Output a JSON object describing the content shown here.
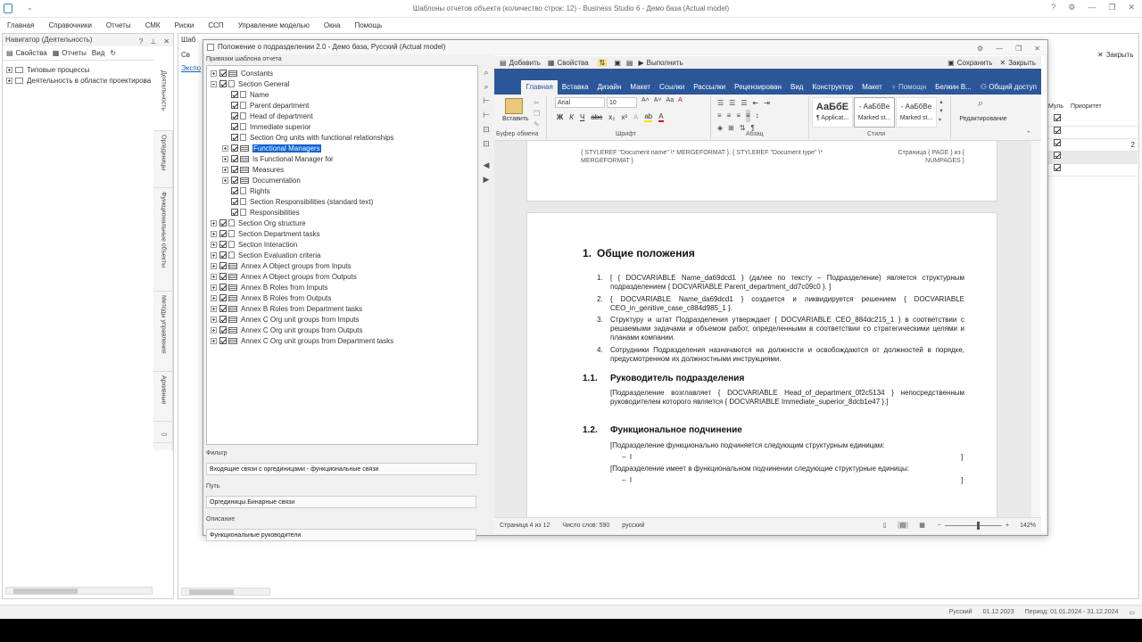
{
  "app": {
    "title": "Шаблоны отчетов объекта (количество строк: 12) - Business Studio 6 - Демо база (Actual model)"
  },
  "menu": [
    "Главная",
    "Справочники",
    "Отчеты",
    "СМК",
    "Риски",
    "ССП",
    "Управление моделью",
    "Окна",
    "Помощь"
  ],
  "navigator": {
    "title": "Навигатор (Деятельность)",
    "toolbar": {
      "properties": "Свойства",
      "reports": "Отчеты",
      "view": "Вид"
    },
    "items": [
      "Типовые процессы",
      "Деятельность в области проектирова"
    ],
    "side_tabs": [
      "Деятельность",
      "Оргединицы",
      "Функциональные объекты",
      "Методы управления",
      "Архивные"
    ]
  },
  "background_window": {
    "title_fragment": "Шаб",
    "tab_fragment": "Св",
    "export_fragment": "Экспо",
    "close_label": "Закрыть",
    "columns": {
      "mult": "Муль",
      "priority": "Приоритет"
    },
    "value": "2"
  },
  "dialog": {
    "title": "Положение о подразделении 2.0 - Демо база, Русский (Actual model)",
    "left_header": "Привязки шаблона отчета",
    "tree": [
      {
        "label": "Constants",
        "level": 0,
        "expand": "plus",
        "icon": "table"
      },
      {
        "label": "Section General",
        "level": 0,
        "expand": "minus",
        "icon": "bracket"
      },
      {
        "label": "Name",
        "level": 1,
        "expand": "none",
        "icon": "bracket"
      },
      {
        "label": "Parent department",
        "level": 1,
        "expand": "none",
        "icon": "bracket"
      },
      {
        "label": "Head of department",
        "level": 1,
        "expand": "none",
        "icon": "bracket"
      },
      {
        "label": "Immediate superior",
        "level": 1,
        "expand": "none",
        "icon": "bracket"
      },
      {
        "label": "Section Org units with functional relationships",
        "level": 1,
        "expand": "none",
        "icon": "bracket"
      },
      {
        "label": "Functional Managers",
        "level": 1,
        "expand": "plus",
        "icon": "table",
        "selected": true
      },
      {
        "label": "Is Functional Manager for",
        "level": 1,
        "expand": "plus",
        "icon": "table"
      },
      {
        "label": "Measures",
        "level": 1,
        "expand": "plus",
        "icon": "table"
      },
      {
        "label": "Documentation",
        "level": 1,
        "expand": "plus",
        "icon": "table"
      },
      {
        "label": "Rights",
        "level": 1,
        "expand": "none",
        "icon": "bracket"
      },
      {
        "label": "Section Responsibilities (standard text)",
        "level": 1,
        "expand": "none",
        "icon": "bracket"
      },
      {
        "label": "Responsibilities",
        "level": 1,
        "expand": "none",
        "icon": "bracket"
      },
      {
        "label": "Section Org structure",
        "level": 0,
        "expand": "plus",
        "icon": "bracket"
      },
      {
        "label": "Section Department tasks",
        "level": 0,
        "expand": "plus",
        "icon": "bracket"
      },
      {
        "label": "Section Interaction",
        "level": 0,
        "expand": "plus",
        "icon": "bracket"
      },
      {
        "label": "Section Evaluation criteria",
        "level": 0,
        "expand": "plus",
        "icon": "bracket"
      },
      {
        "label": "Annex A Object groups from Inputs",
        "level": 0,
        "expand": "plus",
        "icon": "table"
      },
      {
        "label": "Annex A Object groups from Outputs",
        "level": 0,
        "expand": "plus",
        "icon": "table"
      },
      {
        "label": "Annex B Roles from Imputs",
        "level": 0,
        "expand": "plus",
        "icon": "table"
      },
      {
        "label": "Annex B Roles from Outputs",
        "level": 0,
        "expand": "plus",
        "icon": "table"
      },
      {
        "label": "Annex B Roles from Department tasks",
        "level": 0,
        "expand": "plus",
        "icon": "table"
      },
      {
        "label": "Annex C Org unit groups from Imputs",
        "level": 0,
        "expand": "plus",
        "icon": "table"
      },
      {
        "label": "Annex C Org unit groups from Outputs",
        "level": 0,
        "expand": "plus",
        "icon": "table"
      },
      {
        "label": "Annex C Org unit groups from Department tasks",
        "level": 0,
        "expand": "plus",
        "icon": "table"
      }
    ],
    "filter_label": "Фильтр",
    "filter_value": "Входящие связи с оргединицами - функциональные связи",
    "path_label": "Путь",
    "path_value": "Оргединицы.Бинарные связи",
    "desc_label": "Описание",
    "desc_value": "Функциональные руководители"
  },
  "word": {
    "toolbar": {
      "add": "Добавить",
      "properties": "Свойства",
      "execute": "Выполнить",
      "save": "Сохранить",
      "close": "Закрыть"
    },
    "ribbon_tabs": [
      "Главная",
      "Вставка",
      "Дизайн",
      "Макет",
      "Ссылки",
      "Рассылки",
      "Рецензирован",
      "Вид",
      "Конструктор",
      "Макет",
      "Помощн",
      "Белкин В...",
      "Общий доступ"
    ],
    "ribbon": {
      "paste": "Вставить",
      "clipboard": "Буфер обмена",
      "font_name": "Arial",
      "font_size": "10",
      "font_group": "Шрифт",
      "paragraph_group": "Абзац",
      "styles_group": "Стили",
      "styles": [
        {
          "preview": "АаБбЕ",
          "name": "¶ Applicat..."
        },
        {
          "preview": "- АаБбВе",
          "name": "Marked st..."
        },
        {
          "preview": "- АаБбВе",
          "name": "Marked st..."
        }
      ],
      "editing": "Редактирование"
    },
    "header_left": "{ STYLEREF \"Document name\" \\* MERGEFORMAT }. { STYLEREF \"Document type\" \\* MERGEFORMAT }",
    "header_right": "Страница { PAGE } из { NUMPAGES }",
    "doc": {
      "h1_num": "1.",
      "h1": "Общие положения",
      "items": [
        {
          "num": "1.",
          "text": "[ { DOCVARIABLE Name_da69dcd1 } (далее по тексту – Подразделение) является структурным подразделением { DOCVARIABLE Parent_department_dd7c09c0 }. ]"
        },
        {
          "num": "2.",
          "text": "{ DOCVARIABLE Name_da69dcd1 } создается и ликвидируется решением { DOCVARIABLE CEO_in_genitive_case_c884d985_1 }."
        },
        {
          "num": "3.",
          "text": "Структуру и штат Подразделения утверждает { DOCVARIABLE CEO_884dc215_1 } в соответствии с решаемыми задачами и объемом работ, определенными в соответствии со стратегическими целями и планами компании."
        },
        {
          "num": "4.",
          "text": "Сотрудники Подразделения назначаются на должности и освобождаются от должностей в порядке, предусмотренном их должностными инструкциями."
        }
      ],
      "h2a_num": "1.1.",
      "h2a": "Руководитель подразделения",
      "p_a": "[Подразделение возглавляет { DOCVARIABLE Head_of_department_0f2c5134 } непосредственным руководителем которого является { DOCVARIABLE Immediate_superior_8dcb1e47 }.]",
      "h2b_num": "1.2.",
      "h2b": "Функциональное подчинение",
      "p_b1": "[Подразделение функционально подчиняется следующим структурным единицам:",
      "p_b2": "[Подразделение имеет в функциональном подчинении следующие структурные единицы:"
    },
    "status": {
      "page": "Страница 4 из 12",
      "words": "Число слов: 590",
      "lang": "русский",
      "zoom": "142%"
    }
  },
  "bottom_bar": {
    "lang": "Русский",
    "date": "01.12.2023",
    "period": "Период: 01.01.2024 - 31.12.2024"
  }
}
